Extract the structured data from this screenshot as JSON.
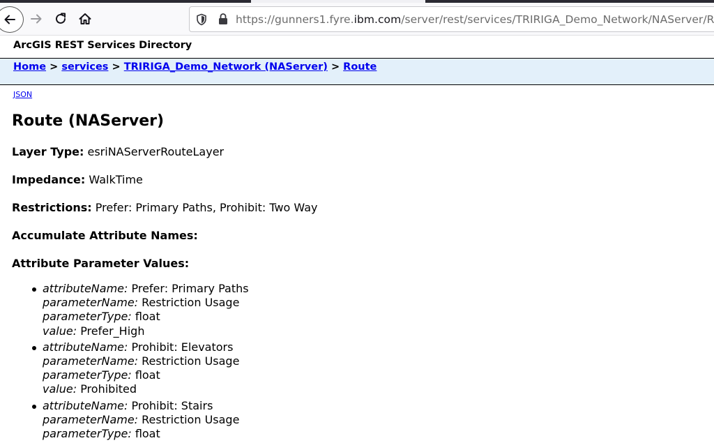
{
  "browser": {
    "url_prefix": "https://gunners1.fyre.",
    "url_host": "ibm.com",
    "url_path": "/server/rest/services/TRIRIGA_Demo_Network/NAServer/Route"
  },
  "page": {
    "directory_title": "ArcGIS REST Services Directory",
    "breadcrumb": {
      "home": "Home",
      "sep1": ">",
      "services": "services",
      "sep2": ">",
      "network": "TRIRIGA_Demo_Network (NAServer)",
      "sep3": ">",
      "route": "Route"
    },
    "json_link": "JSON",
    "title": "Route (NAServer)",
    "properties": {
      "layer_type_label": "Layer Type:",
      "layer_type_value": "esriNAServerRouteLayer",
      "impedance_label": "Impedance:",
      "impedance_value": "WalkTime",
      "restrictions_label": "Restrictions:",
      "restrictions_value": "Prefer: Primary Paths, Prohibit: Two Way",
      "accumulate_label": "Accumulate Attribute Names:",
      "attr_params_label": "Attribute Parameter Values:"
    },
    "field_labels": {
      "attributeName": "attributeName:",
      "parameterName": "parameterName:",
      "parameterType": "parameterType:",
      "value": "value:"
    },
    "attribute_parameters": [
      {
        "attributeName": "Prefer: Primary Paths",
        "parameterName": "Restriction Usage",
        "parameterType": "float",
        "value": "Prefer_High"
      },
      {
        "attributeName": "Prohibit: Elevators",
        "parameterName": "Restriction Usage",
        "parameterType": "float",
        "value": "Prohibited"
      },
      {
        "attributeName": "Prohibit: Stairs",
        "parameterName": "Restriction Usage",
        "parameterType": "float"
      }
    ]
  },
  "colors": {
    "link": "#0000ee",
    "navbar_bg": "#e3f0fa",
    "chrome_bg": "#f9f9fb"
  }
}
